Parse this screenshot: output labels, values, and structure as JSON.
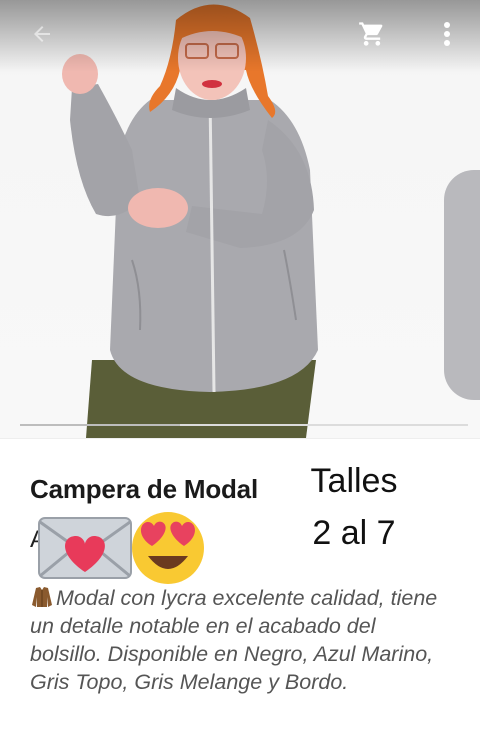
{
  "appbar": {
    "back_icon": "arrow-back-icon",
    "cart_icon": "shopping-cart-icon",
    "more_icon": "more-vert-icon"
  },
  "product": {
    "title": "Campera de Modal",
    "price_partial": "A",
    "overlay_text": {
      "line1": "Talles",
      "line2": "2 al 7"
    },
    "emoji": [
      "love-letter-emoji",
      "heart-eyes-emoji"
    ],
    "description_icon": "coat-emoji",
    "description": "Modal con lycra excelente calidad, tiene un detalle notable en el acabado del bolsillo. Disponible en Negro, Azul Marino, Gris Topo, Gris Melange y Bordo."
  },
  "colors": {
    "title": "#1a1a1a",
    "description": "#555555",
    "jacket": "#a9a9ae",
    "pants": "#5a5e38",
    "hair": "#e8772b"
  }
}
